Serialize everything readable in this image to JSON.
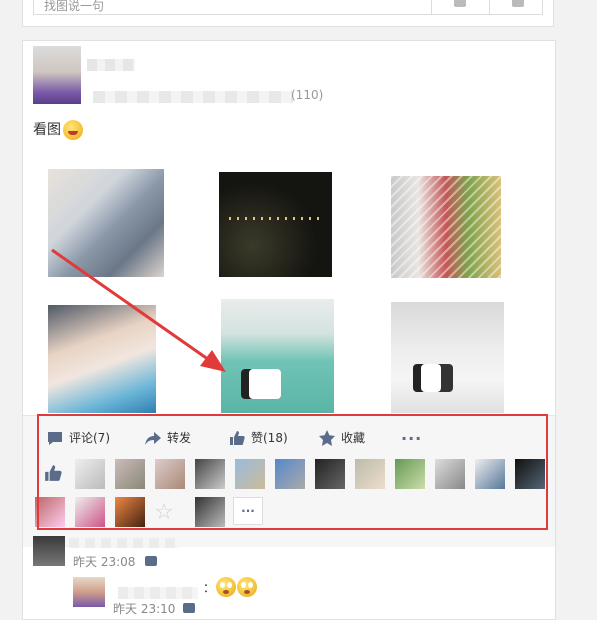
{
  "search": {
    "placeholder_text": "找图说一句"
  },
  "post": {
    "meta": "(110)",
    "text": "看图"
  },
  "actions": {
    "comment_label": "评论(7)",
    "repost_label": "转发",
    "like_label": "赞(18)",
    "favorite_label": "收藏",
    "more_label": "···"
  },
  "likes": {
    "more_label": "···"
  },
  "comments": [
    {
      "time": "昨天 23:08"
    },
    {
      "time": "昨天 23:10",
      "text": "："
    }
  ],
  "colors": {
    "annotation_red": "#e03a3a",
    "icon_blue": "#5b6c8a"
  }
}
